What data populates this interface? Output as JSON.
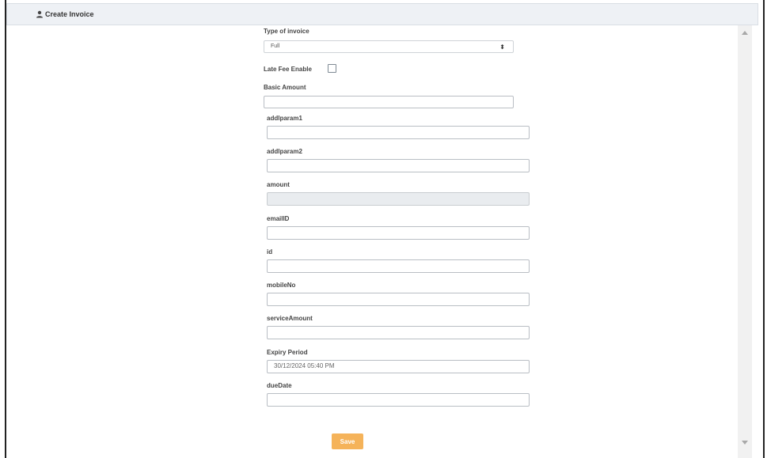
{
  "panel": {
    "title": "Create Invoice",
    "icon": "user-icon"
  },
  "form": {
    "type_of_invoice": {
      "label": "Type of invoice",
      "selected": "Full"
    },
    "late_fee": {
      "label": "Late Fee Enable",
      "checked": false
    },
    "basic_amount": {
      "label": "Basic Amount",
      "value": ""
    },
    "addlparam1": {
      "label": "addlparam1",
      "value": ""
    },
    "addlparam2": {
      "label": "addlparam2",
      "value": ""
    },
    "amount": {
      "label": "amount",
      "value": "",
      "disabled": true
    },
    "emailID": {
      "label": "emailID",
      "value": ""
    },
    "id": {
      "label": "id",
      "value": ""
    },
    "mobileNo": {
      "label": "mobileNo",
      "value": ""
    },
    "serviceAmount": {
      "label": "serviceAmount",
      "value": ""
    },
    "expiry_period": {
      "label": "Expiry Period",
      "value": "30/12/2024 05:40 PM"
    },
    "dueDate": {
      "label": "dueDate",
      "value": ""
    },
    "save_label": "Save"
  },
  "colors": {
    "save_button": "#f5b35a",
    "header_bg": "#eef1f5",
    "disabled_input": "#e9ecef"
  }
}
